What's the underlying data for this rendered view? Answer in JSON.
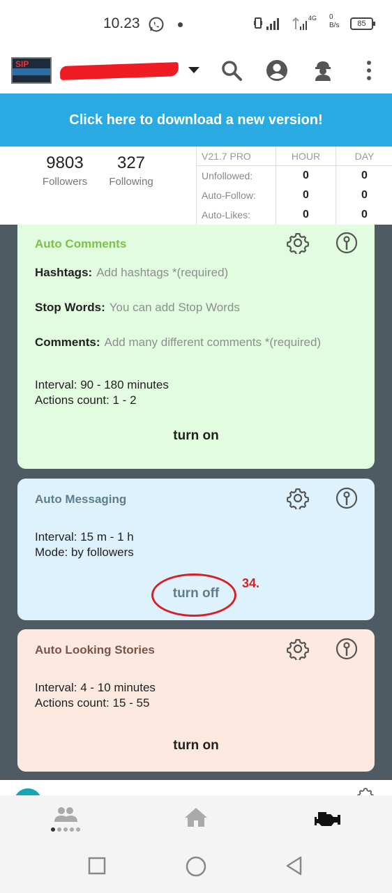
{
  "status_bar": {
    "time": "10.23",
    "network": "4G",
    "speed_value": "0",
    "speed_unit": "B/s",
    "battery": "85"
  },
  "toolbar": {
    "icons": [
      "dropdown-arrow-icon",
      "search-icon",
      "account-circle-icon",
      "worker-icon",
      "more-vertical-icon"
    ]
  },
  "banner": {
    "text": "Click here to download a new version!",
    "color": "#29aae2"
  },
  "stats": {
    "followers": {
      "value": "9803",
      "label": "Followers"
    },
    "following": {
      "value": "327",
      "label": "Following"
    },
    "table": {
      "version": "V21.7 PRO",
      "col_hour": "HOUR",
      "col_day": "DAY",
      "rows": [
        {
          "label": "Unfollowed:",
          "hour": "0",
          "day": "0"
        },
        {
          "label": "Auto-Follow:",
          "hour": "0",
          "day": "0"
        },
        {
          "label": "Auto-Likes:",
          "hour": "0",
          "day": "0"
        }
      ]
    }
  },
  "cards": {
    "comments": {
      "title": "Auto Comments",
      "title_color": "#7cc24a",
      "bg": "#e2fce0",
      "hashtags_label": "Hashtags:",
      "hashtags_placeholder": "Add hashtags *(required)",
      "stopwords_label": "Stop Words:",
      "stopwords_placeholder": "You can add Stop Words",
      "comments_label": "Comments:",
      "comments_placeholder": "Add many different comments *(required)",
      "interval": "Interval: 90 - 180 minutes",
      "actions": "Actions count: 1 - 2",
      "button": "turn on"
    },
    "messaging": {
      "title": "Auto Messaging",
      "title_color": "#5f7d8c",
      "bg": "#def2fd",
      "interval": "Interval: 15 m - 1 h",
      "mode": "Mode: by followers",
      "button": "turn off",
      "annotation": "34."
    },
    "stories": {
      "title": "Auto Looking Stories",
      "title_color": "#795548",
      "bg": "#fde9df",
      "interval": "Interval: 4 - 10 minutes",
      "actions": "Actions count: 15 - 55",
      "button": "turn on"
    }
  },
  "bottom_nav": [
    "people-icon",
    "home-icon",
    "engine-icon"
  ],
  "system_nav": [
    "recent-apps-icon",
    "home-circle-icon",
    "back-icon"
  ]
}
